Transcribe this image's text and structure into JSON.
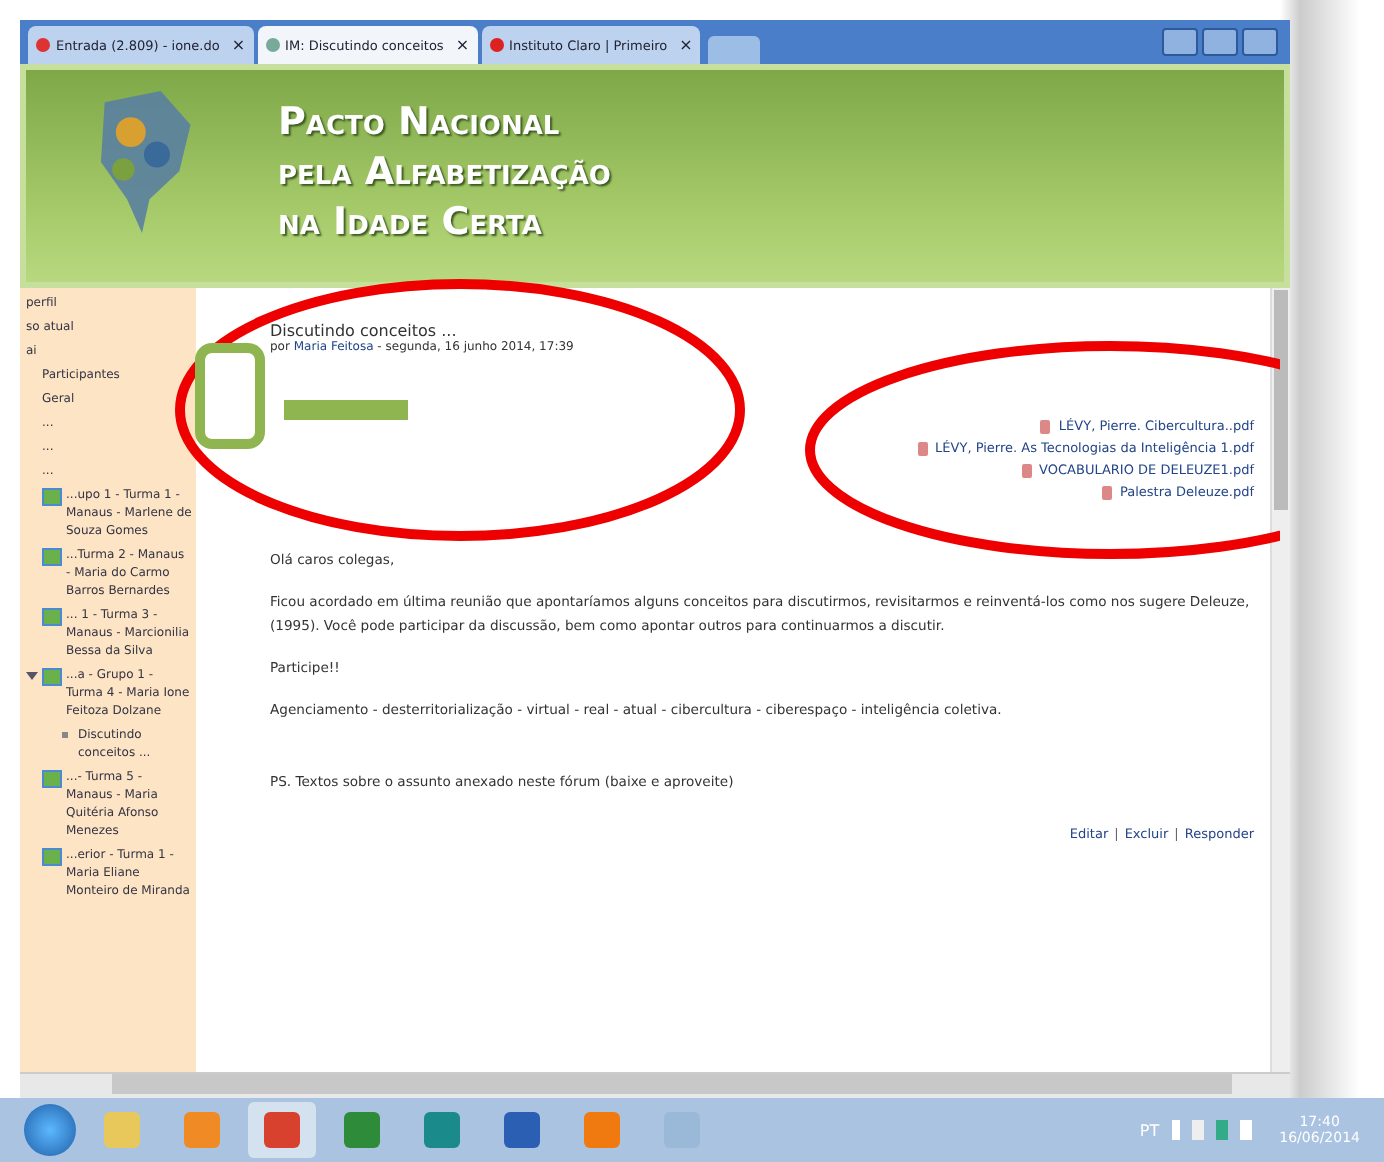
{
  "browser": {
    "tabs": [
      {
        "label": "Entrada (2.809) - ione.do",
        "selected": false
      },
      {
        "label": "IM: Discutindo conceitos",
        "selected": true
      },
      {
        "label": "Instituto Claro | Primeiro",
        "selected": false
      }
    ],
    "close_glyph": "×"
  },
  "banner": {
    "title_lines": [
      "Pacto Nacional",
      "pela  Alfabetização",
      "na Idade Certa"
    ]
  },
  "sidebar": {
    "links": [
      "perfil",
      "so atual",
      "ai"
    ],
    "items": [
      "Participantes",
      "Geral",
      "...",
      "...",
      "..."
    ],
    "forums": [
      {
        "label": "...upo 1 - Turma 1 - Manaus - Marlene de Souza Gomes",
        "expanded": false
      },
      {
        "label": "...Turma 2 - Manaus - Maria do Carmo Barros Bernardes",
        "expanded": false
      },
      {
        "label": "... 1 - Turma 3 - Manaus - Marcionilia Bessa da Silva",
        "expanded": false
      },
      {
        "label": "...a - Grupo 1 - Turma 4 - Maria Ione Feitoza Dolzane",
        "expanded": true,
        "children": [
          {
            "label": "Discutindo conceitos ..."
          }
        ]
      },
      {
        "label": "...- Turma 5 - Manaus - Maria Quitéria Afonso Menezes",
        "expanded": false
      },
      {
        "label": "...erior - Turma 1 - Maria Eliane Monteiro de Miranda",
        "expanded": false
      }
    ]
  },
  "post": {
    "subject": "Discutindo conceitos ...",
    "byline_prefix": "por",
    "author": "Maria Feitosa",
    "date": " - segunda, 16 junho 2014, 17:39",
    "attachments": [
      "LÉVY, Pierre. Cibercultura..pdf",
      "LÉVY, Pierre. As Tecnologias da Inteligência 1.pdf",
      "VOCABULARIO DE DELEUZE1.pdf",
      "Palestra Deleuze.pdf"
    ],
    "paragraphs": [
      "Olá caros colegas,",
      "Ficou acordado em última reunião que apontaríamos alguns conceitos para discutirmos, revisitarmos e reinventá-los como nos sugere Deleuze, (1995). Você pode participar da discussão, bem como apontar outros para continuarmos a discutir.",
      "Participe!!",
      "Agenciamento - desterritorialização - virtual - real - atual - cibercultura - ciberespaço - inteligência coletiva."
    ],
    "ps": "PS. Textos sobre o assunto anexado neste fórum (baixe e aproveite)",
    "actions": [
      "Editar",
      "Excluir",
      "Responder"
    ],
    "action_separator": "|"
  },
  "taskbar": {
    "apps": [
      {
        "kind": "folder"
      },
      {
        "kind": "media"
      },
      {
        "kind": "browser",
        "selected": true
      },
      {
        "kind": "excel"
      },
      {
        "kind": "publisher"
      },
      {
        "kind": "word"
      },
      {
        "kind": "pdf"
      },
      {
        "kind": "paint"
      }
    ],
    "language": "PT",
    "time": "17:40",
    "date": "16/06/2014"
  }
}
